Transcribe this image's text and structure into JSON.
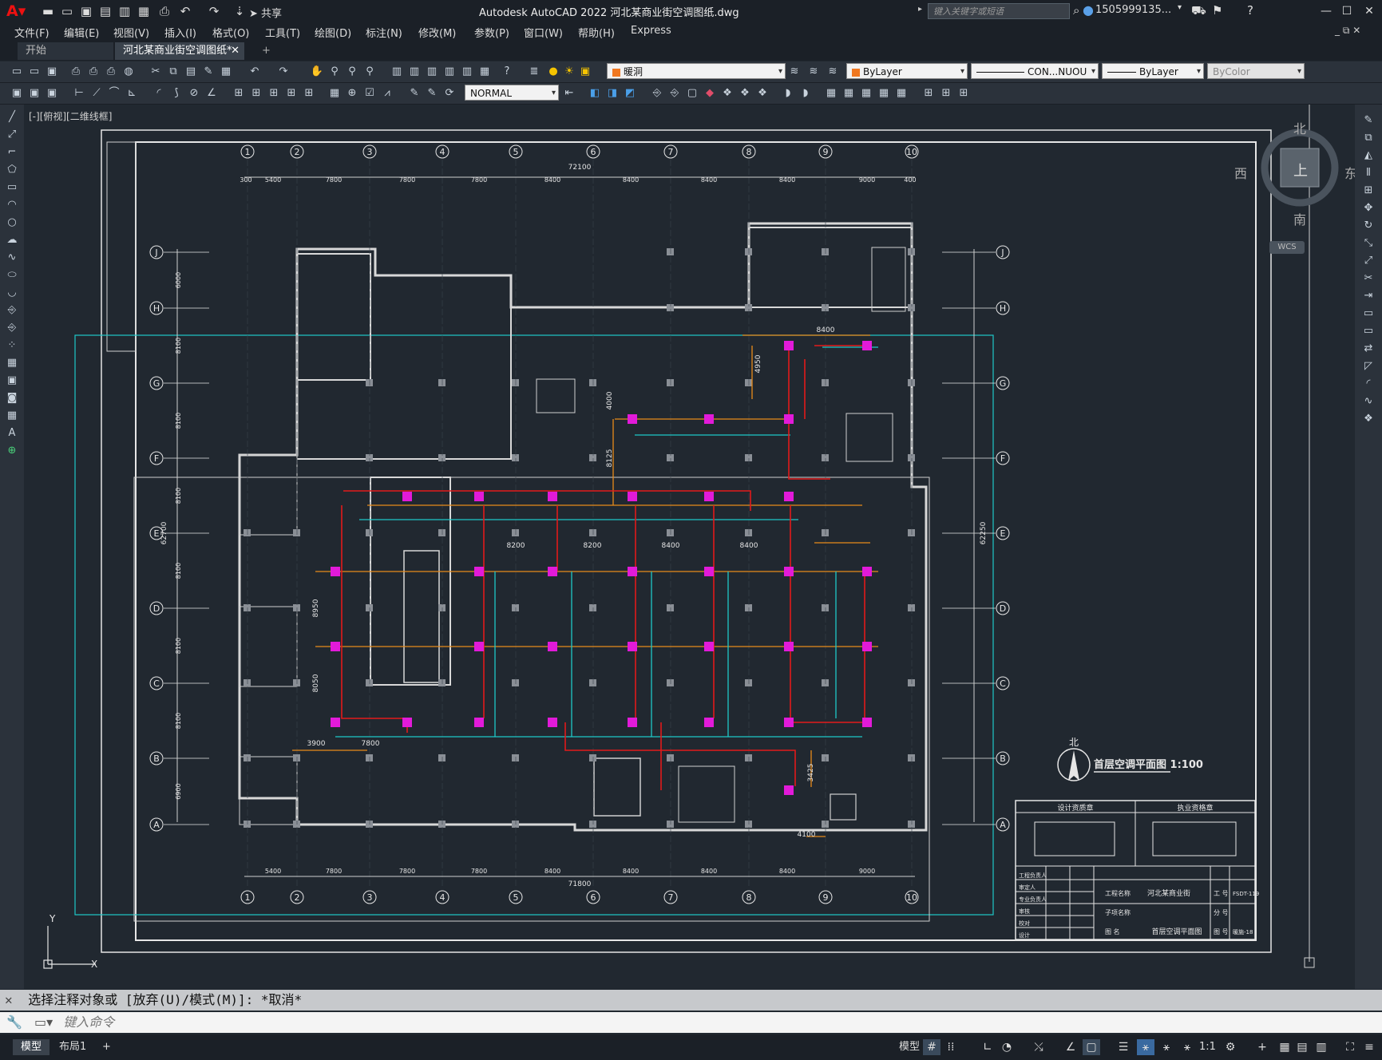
{
  "app": {
    "title": "Autodesk AutoCAD 2022    河北某商业街空调图纸.dwg",
    "search_placeholder": "键入关键字或短语",
    "user": "1505999135...",
    "share_label": "共享"
  },
  "menus": [
    "文件(F)",
    "编辑(E)",
    "视图(V)",
    "插入(I)",
    "格式(O)",
    "工具(T)",
    "绘图(D)",
    "标注(N)",
    "修改(M)",
    "参数(P)",
    "窗口(W)",
    "帮助(H)",
    "Express"
  ],
  "tabs": {
    "start": "开始",
    "active": "河北某商业街空调图纸*"
  },
  "toolbar": {
    "layer": "暖洞",
    "color": "ByLayer",
    "linetype": "CON...NUOU",
    "lineweight": "ByLayer",
    "plotstyle": "ByColor",
    "textstyle": "NORMAL"
  },
  "viewport": {
    "label": "[-][俯视][二维线框]"
  },
  "viewcube": {
    "north": "北",
    "south": "南",
    "east": "东",
    "west": "西",
    "face": "上",
    "wcs": "WCS"
  },
  "drawing": {
    "axis_numbers": [
      "1",
      "2",
      "3",
      "4",
      "5",
      "6",
      "7",
      "8",
      "9",
      "10"
    ],
    "axis_letters": [
      "J",
      "H",
      "G",
      "F",
      "E",
      "D",
      "C",
      "B",
      "A"
    ],
    "top_total": "72100",
    "bottom_total": "71800",
    "top_dims": [
      "300",
      "5400",
      "7800",
      "7800",
      "7800",
      "8400",
      "8400",
      "8400",
      "8400",
      "9000",
      "400"
    ],
    "bottom_dims": [
      "5400",
      "7800",
      "7800",
      "7800",
      "8400",
      "8400",
      "8400",
      "8400",
      "9000"
    ],
    "left_dims": [
      "6000",
      "8100",
      "8100",
      "8100",
      "8100",
      "8100",
      "8100",
      "6900"
    ],
    "left_total": "62700",
    "right_total": "62250",
    "interior_dims": [
      "8400",
      "8200",
      "8200",
      "8400",
      "8400",
      "3900",
      "7800",
      "4100",
      "3425",
      "4950",
      "4000",
      "8125",
      "8950",
      "8050"
    ],
    "plan_title": "首层空调平面图 1:100",
    "north_label": "北",
    "titleblock": {
      "left_header": "设计资质章",
      "right_header": "执业资格章",
      "project_name_label": "工程名称",
      "project_name": "河北某商业街",
      "sub_project_label": "子项名称",
      "drawing_name_label": "图  名",
      "drawing_name": "首层空调平面图",
      "no_label": "工 号",
      "no_value": "FSDT-119",
      "part_label": "分 号",
      "figure_label": "图 号",
      "figure_value": "暖施-18",
      "rows": [
        "工程负责人",
        "审定人",
        "专业负责人",
        "审核",
        "校对",
        "设计"
      ]
    }
  },
  "command": {
    "history": "选择注释对象或 [放弃(U)/模式(M)]: *取消*",
    "placeholder": "键入命令"
  },
  "status": {
    "tabs": [
      "模型",
      "布局1"
    ],
    "model_label": "模型",
    "scale": "1:1"
  }
}
